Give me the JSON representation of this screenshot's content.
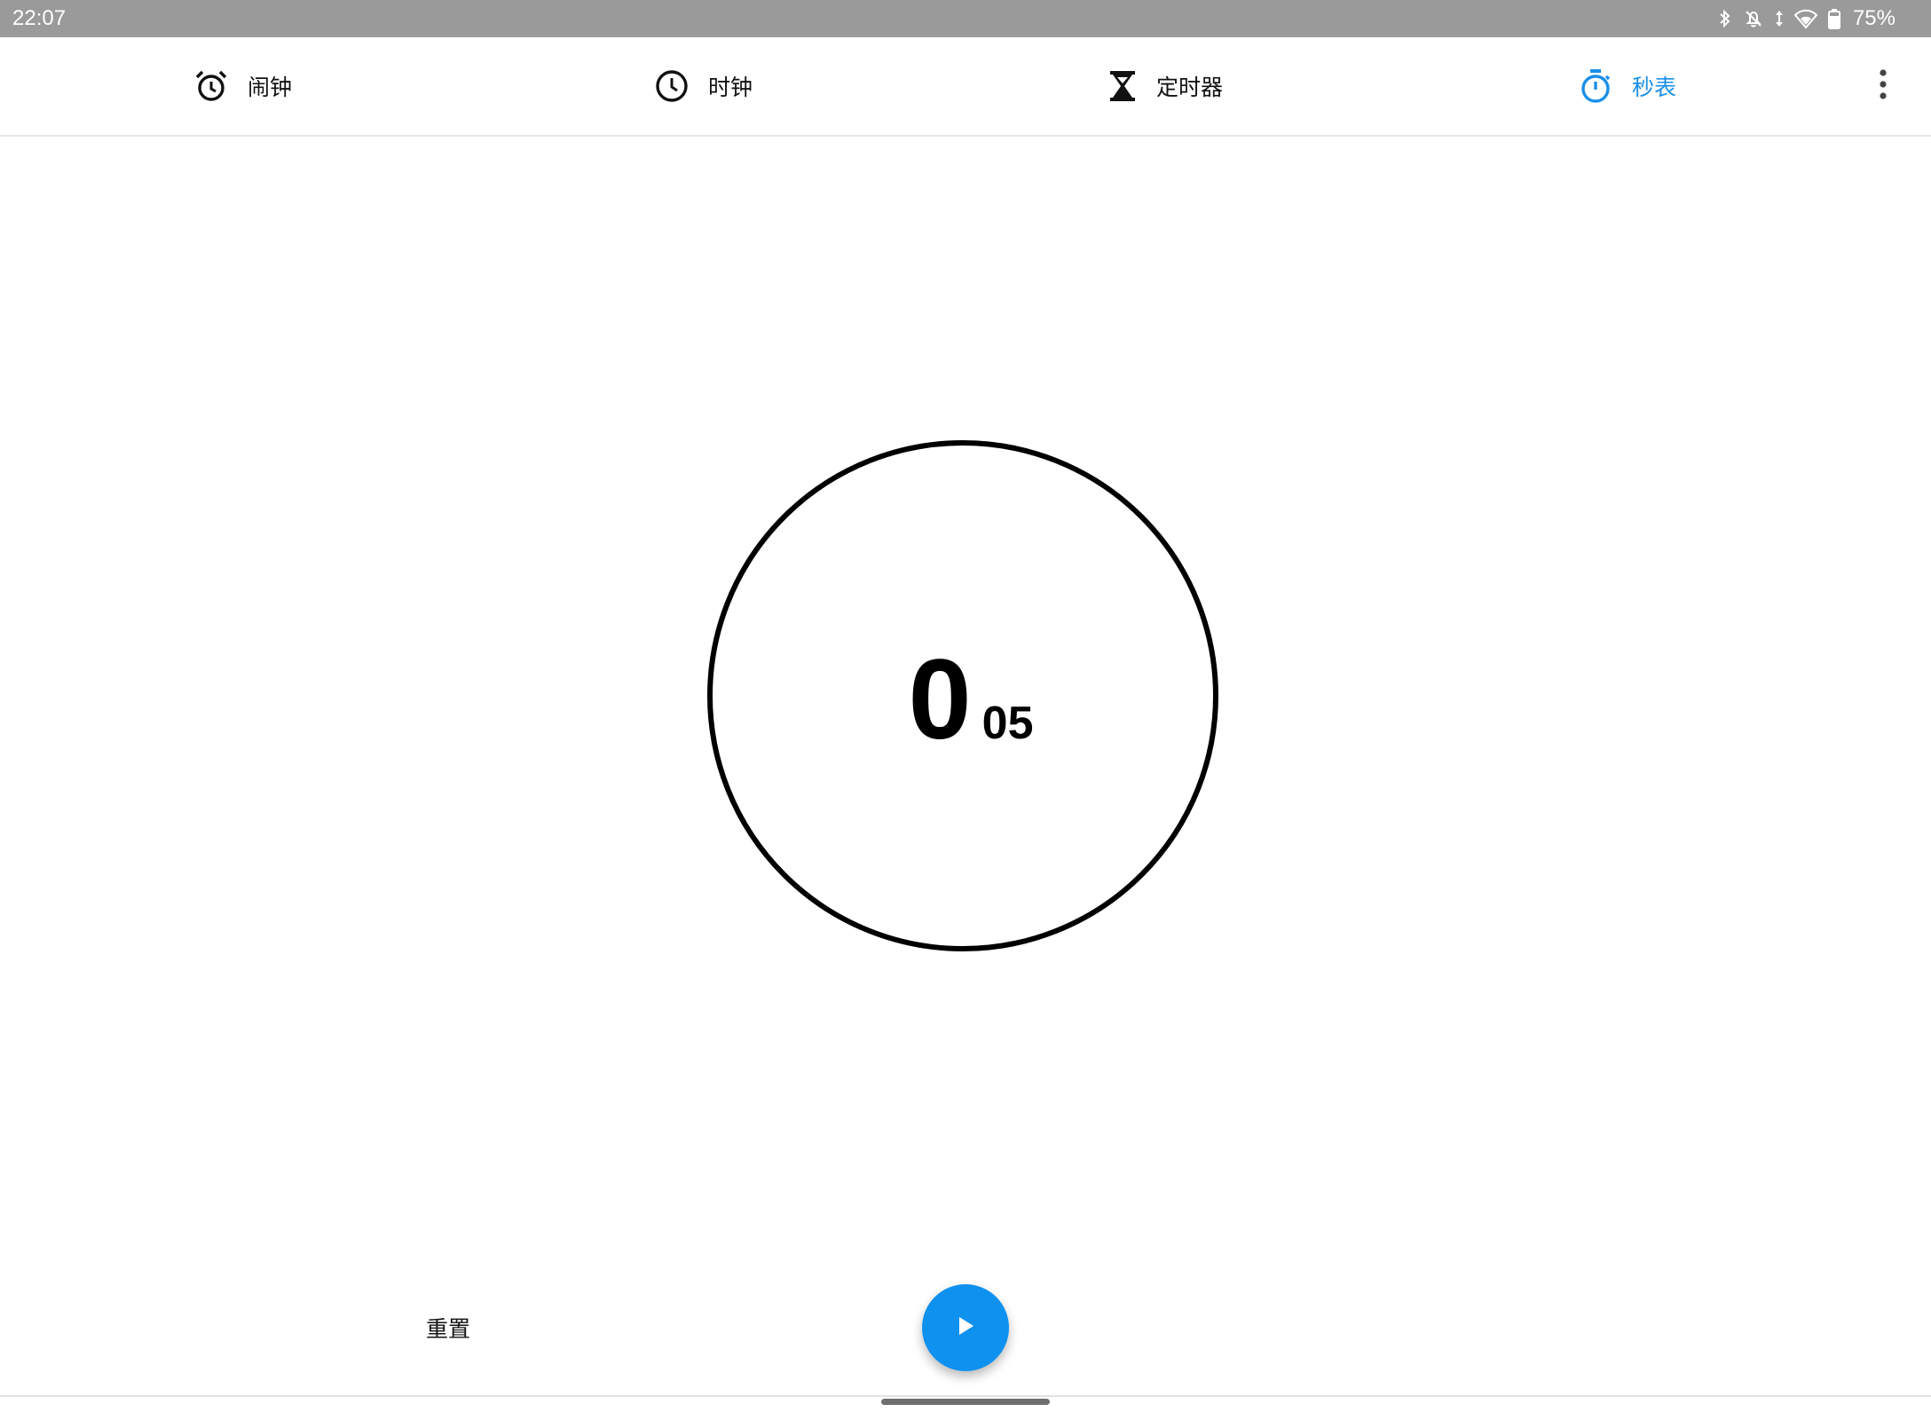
{
  "status_bar": {
    "time": "22:07",
    "icons": [
      "bluetooth-icon",
      "notifications-off-icon",
      "data-arrows-icon",
      "wifi-icon",
      "battery-icon"
    ],
    "battery": "75%"
  },
  "tabs": [
    {
      "label": "闹钟",
      "icon": "alarm-icon",
      "active": false
    },
    {
      "label": "时钟",
      "icon": "clock-icon",
      "active": false
    },
    {
      "label": "定时器",
      "icon": "hourglass-icon",
      "active": false
    },
    {
      "label": "秒表",
      "icon": "stopwatch-icon",
      "active": true
    }
  ],
  "menu": {
    "icon": "more-vert-icon"
  },
  "stopwatch": {
    "seconds": "0",
    "hundredths": "05"
  },
  "controls": {
    "reset_label": "重置",
    "play_icon": "play-icon"
  },
  "colors": {
    "accent": "#1a8fe8",
    "fab": "#0f91f0",
    "status_bar": "#9a9a9a"
  }
}
